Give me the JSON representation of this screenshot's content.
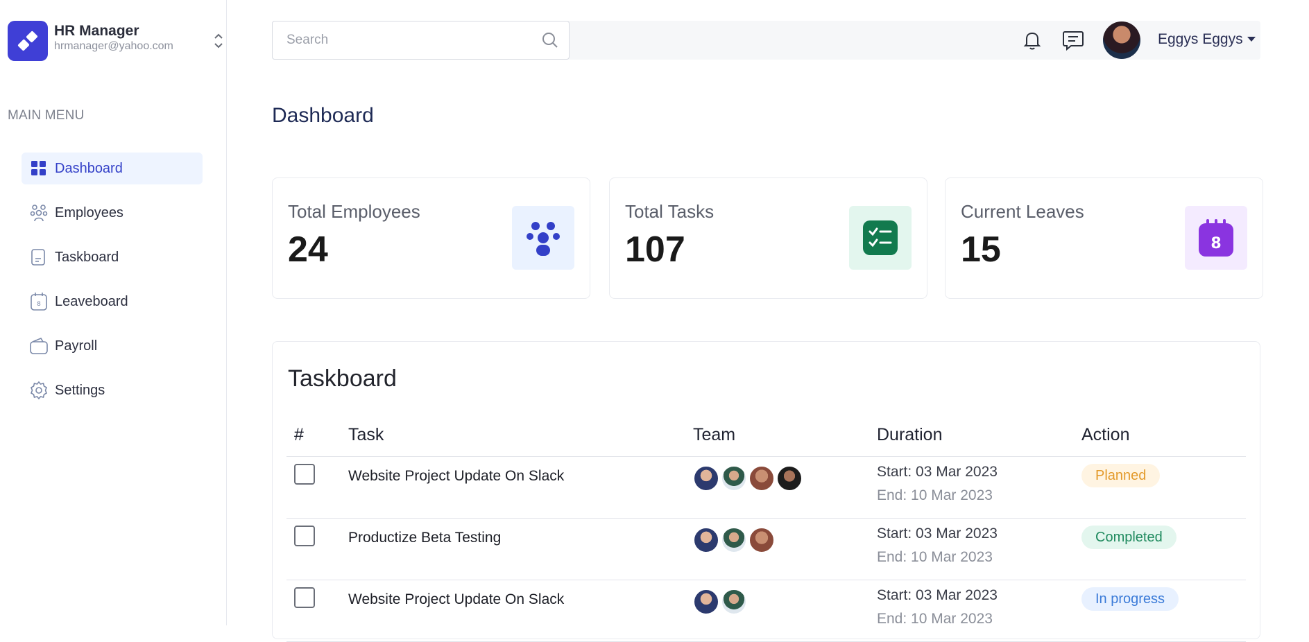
{
  "brand": {
    "name": "HR Manager",
    "email": "hrmanager@yahoo.com"
  },
  "sidebar": {
    "caption": "MAIN MENU",
    "items": [
      {
        "label": "Dashboard",
        "icon": "grid-icon",
        "active": true
      },
      {
        "label": "Employees",
        "icon": "people-icon"
      },
      {
        "label": "Taskboard",
        "icon": "document-icon"
      },
      {
        "label": "Leaveboard",
        "icon": "calendar-icon"
      },
      {
        "label": "Payroll",
        "icon": "wallet-icon"
      },
      {
        "label": "Settings",
        "icon": "gear-icon"
      }
    ]
  },
  "topbar": {
    "search_placeholder": "Search",
    "user_name": "Eggys Eggys"
  },
  "page": {
    "title": "Dashboard"
  },
  "stats": [
    {
      "label": "Total Employees",
      "value": "24",
      "icon": "people-icon",
      "icon_bg": "#eaf2ff",
      "icon_color": "#3340c8"
    },
    {
      "label": "Total Tasks",
      "value": "107",
      "icon": "checklist-icon",
      "icon_bg": "#e3f6ee",
      "icon_color": "#127a4e"
    },
    {
      "label": "Current Leaves",
      "value": "15",
      "icon": "calendar-icon",
      "icon_text": "8",
      "icon_bg": "#f4ebff",
      "icon_color": "#8a34e0"
    }
  ],
  "taskboard": {
    "title": "Taskboard",
    "columns": [
      "#",
      "Task",
      "Team",
      "Duration",
      "Action"
    ],
    "rows": [
      {
        "task": "Website Project Update On Slack",
        "start": "Start: 03 Mar 2023",
        "end": "End: 10 Mar 2023",
        "status": "Planned",
        "status_bg": "#fff4e2",
        "status_color": "#e39a2b",
        "team_size": 4
      },
      {
        "task": "Productize Beta Testing",
        "start": "Start: 03 Mar 2023",
        "end": "End: 10 Mar 2023",
        "status": "Completed",
        "status_bg": "#e3f6ee",
        "status_color": "#1f8a5e",
        "team_size": 3
      },
      {
        "task": "Website Project Update On Slack",
        "start": "Start: 03 Mar 2023",
        "end": "End: 10 Mar 2023",
        "status": "In progress",
        "status_bg": "#e8f1ff",
        "status_color": "#3b7bd8",
        "team_size": 2
      }
    ]
  },
  "colors": {
    "accent": "#3f3fd6",
    "nav_active_bg": "#eef4ff"
  }
}
